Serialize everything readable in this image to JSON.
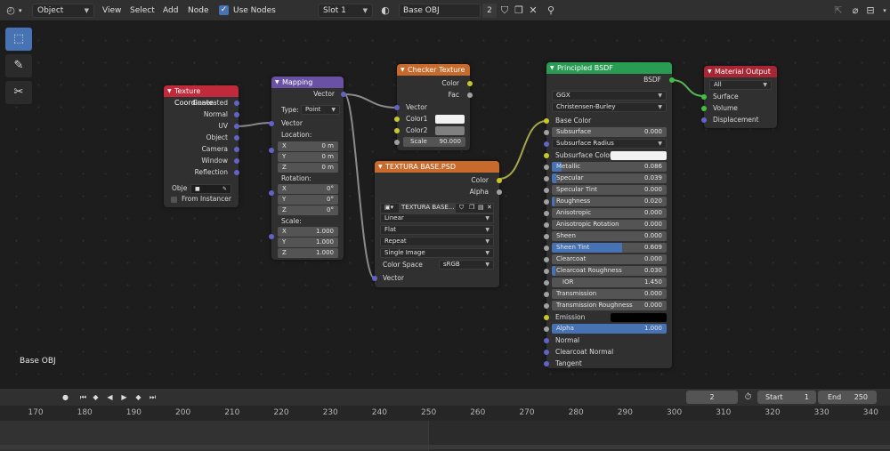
{
  "header": {
    "mode": "Object",
    "menus": [
      "View",
      "Select",
      "Add",
      "Node"
    ],
    "use_nodes_label": "Use Nodes",
    "slot": "Slot 1",
    "material_name": "Base OBJ",
    "users": "2"
  },
  "editor": {
    "context_label": "Base OBJ"
  },
  "nodes": {
    "tex_coord": {
      "title": "Texture Coordinate",
      "outputs": [
        "Generated",
        "Normal",
        "UV",
        "Object",
        "Camera",
        "Window",
        "Reflection"
      ],
      "object_label": "Obje",
      "from_instancer": "From Instancer"
    },
    "mapping": {
      "title": "Mapping",
      "output": "Vector",
      "type_label": "Type:",
      "type_value": "Point",
      "vector_label": "Vector",
      "location_label": "Location:",
      "location": [
        {
          "axis": "X",
          "value": "0 m"
        },
        {
          "axis": "Y",
          "value": "0 m"
        },
        {
          "axis": "Z",
          "value": "0 m"
        }
      ],
      "rotation_label": "Rotation:",
      "rotation": [
        {
          "axis": "X",
          "value": "0°"
        },
        {
          "axis": "Y",
          "value": "0°"
        },
        {
          "axis": "Z",
          "value": "0°"
        }
      ],
      "scale_label": "Scale:",
      "scale": [
        {
          "axis": "X",
          "value": "1.000"
        },
        {
          "axis": "Y",
          "value": "1.000"
        },
        {
          "axis": "Z",
          "value": "1.000"
        }
      ]
    },
    "checker": {
      "title": "Checker Texture",
      "outputs": [
        "Color",
        "Fac"
      ],
      "inputs": [
        "Vector",
        "Color1",
        "Color2"
      ],
      "scale_label": "Scale",
      "scale_value": "90.000",
      "color1": "#f2f2f2",
      "color2": "#808080"
    },
    "image": {
      "title": "TEXTURA BASE.PSD",
      "outputs": [
        "Color",
        "Alpha"
      ],
      "image_name": "TEXTURA BASE...",
      "interpolation": "Linear",
      "projection": "Flat",
      "extension": "Repeat",
      "source": "Single Image",
      "color_space_label": "Color Space",
      "color_space": "sRGB",
      "input": "Vector"
    },
    "bsdf": {
      "title": "Principled BSDF",
      "output": "BSDF",
      "distribution": "GGX",
      "subsurface_method": "Christensen-Burley",
      "base_color": "Base Color",
      "subsurface": {
        "label": "Subsurface",
        "value": "0.000"
      },
      "subsurface_radius": "Subsurface Radius",
      "subsurface_color": "Subsurface Color",
      "params": [
        {
          "label": "Metallic",
          "value": "0.086",
          "fill": 0.086
        },
        {
          "label": "Specular",
          "value": "0.039",
          "fill": 0.039
        },
        {
          "label": "Specular Tint",
          "value": "0.000",
          "fill": 0
        },
        {
          "label": "Roughness",
          "value": "0.020",
          "fill": 0.02
        },
        {
          "label": "Anisotropic",
          "value": "0.000",
          "fill": 0
        },
        {
          "label": "Anisotropic Rotation",
          "value": "0.000",
          "fill": 0
        },
        {
          "label": "Sheen",
          "value": "0.000",
          "fill": 0
        },
        {
          "label": "Sheen Tint",
          "value": "0.609",
          "fill": 0.609
        },
        {
          "label": "Clearcoat",
          "value": "0.000",
          "fill": 0
        },
        {
          "label": "Clearcoat Roughness",
          "value": "0.030",
          "fill": 0.03
        },
        {
          "label": "IOR",
          "value": "1.450",
          "fill": 0
        },
        {
          "label": "Transmission",
          "value": "0.000",
          "fill": 0
        },
        {
          "label": "Transmission Roughness",
          "value": "0.000",
          "fill": 0
        }
      ],
      "emission": "Emission",
      "alpha": {
        "label": "Alpha",
        "value": "1.000"
      },
      "normal": "Normal",
      "clearcoat_normal": "Clearcoat Normal",
      "tangent": "Tangent"
    },
    "output": {
      "title": "Material Output",
      "target": "All",
      "inputs": [
        "Surface",
        "Volume",
        "Displacement"
      ]
    }
  },
  "timeline": {
    "current_frame": "2",
    "start_label": "Start",
    "start": "1",
    "end_label": "End",
    "end": "250",
    "ticks": [
      "170",
      "180",
      "190",
      "200",
      "210",
      "220",
      "230",
      "240",
      "250",
      "260",
      "270",
      "280",
      "290",
      "300",
      "310",
      "320",
      "330",
      "340"
    ]
  },
  "colors": {
    "input_header": "#c02a3a",
    "vector_header": "#6a51a4",
    "texture_header": "#c76a2c",
    "shader_header": "#2a9b53",
    "output_header": "#a82533",
    "accent": "#4772b3"
  }
}
